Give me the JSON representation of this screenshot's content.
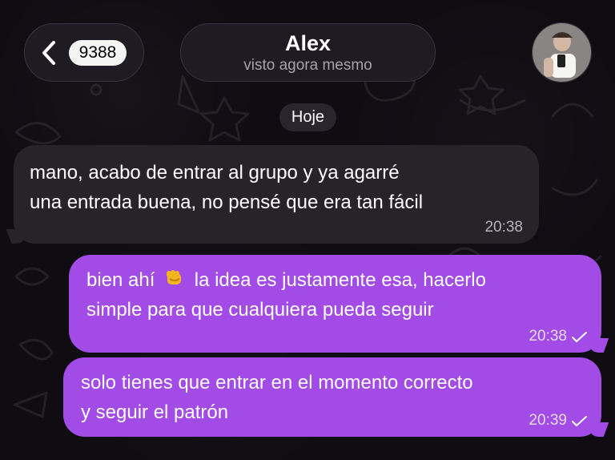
{
  "header": {
    "back_badge": "9388",
    "contact_name": "Alex",
    "status": "visto agora mesmo"
  },
  "chat": {
    "date_separator": "Hoje",
    "messages": [
      {
        "direction": "incoming",
        "lines": [
          "mano, acabo de entrar al grupo y ya agarré",
          "una entrada buena, no pensé que era tan fácil"
        ],
        "time": "20:38"
      },
      {
        "direction": "outgoing",
        "line1_before_emoji": "bien ahí",
        "line1_after_emoji": "la idea es justamente esa, hacerlo",
        "line2": "simple para que cualquiera pueda seguir",
        "time": "20:38",
        "read_indicator": "checkmark-icon"
      },
      {
        "direction": "outgoing",
        "lines": [
          "solo tienes que entrar en el momento correcto",
          "y seguir el patrón"
        ],
        "time": "20:39",
        "read_indicator": "checkmark-icon"
      }
    ]
  },
  "colors": {
    "background": "#0f0d12",
    "incoming_bubble": "#272329",
    "outgoing_bubble": "#a24be6",
    "header_pill": "#1f1b22"
  },
  "icons": {
    "back": "chevron-left-icon",
    "emoji": "fist-emoji-icon",
    "status": "checkmark-icon"
  }
}
